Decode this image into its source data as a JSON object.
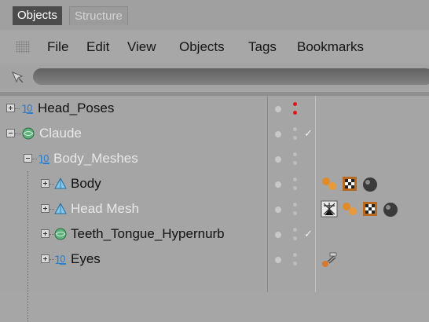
{
  "tabs": [
    {
      "label": "Objects",
      "active": true
    },
    {
      "label": "Structure",
      "active": false
    }
  ],
  "menu": [
    "File",
    "Edit",
    "View",
    "Objects",
    "Tags",
    "Bookmarks"
  ],
  "objects": [
    {
      "name": "Head_Poses",
      "icon": "null-object-icon",
      "dim": false,
      "vis": "red",
      "check": false,
      "tags": []
    },
    {
      "name": "Claude",
      "icon": "hypernurbs-icon",
      "dim": true,
      "vis": "grey",
      "check": true,
      "tags": []
    },
    {
      "name": "Body_Meshes",
      "icon": "null-object-icon",
      "dim": true,
      "vis": "grey",
      "check": false,
      "tags": []
    },
    {
      "name": "Body",
      "icon": "polygon-object-icon",
      "dim": false,
      "vis": "grey",
      "check": false,
      "tags": [
        "phong-tag-icon",
        "texture-tag-icon",
        "material-tag-icon"
      ]
    },
    {
      "name": "Head Mesh",
      "icon": "polygon-object-icon",
      "dim": true,
      "vis": "grey",
      "check": false,
      "tags": [
        "skin-tag-icon",
        "phong-tag-icon",
        "texture-tag-icon",
        "material-tag-icon"
      ]
    },
    {
      "name": "Teeth_Tongue_Hypernurb",
      "icon": "hypernurbs-icon",
      "dim": false,
      "vis": "grey",
      "check": true,
      "tags": []
    },
    {
      "name": "Eyes",
      "icon": "null-object-icon",
      "dim": false,
      "vis": "grey",
      "check": false,
      "tags": [
        "constraint-tag-icon"
      ]
    }
  ],
  "colors": {
    "visible_red": "#e01818",
    "visible_grey": "#bdbdbd",
    "active_tab": "#4c4c4c"
  }
}
